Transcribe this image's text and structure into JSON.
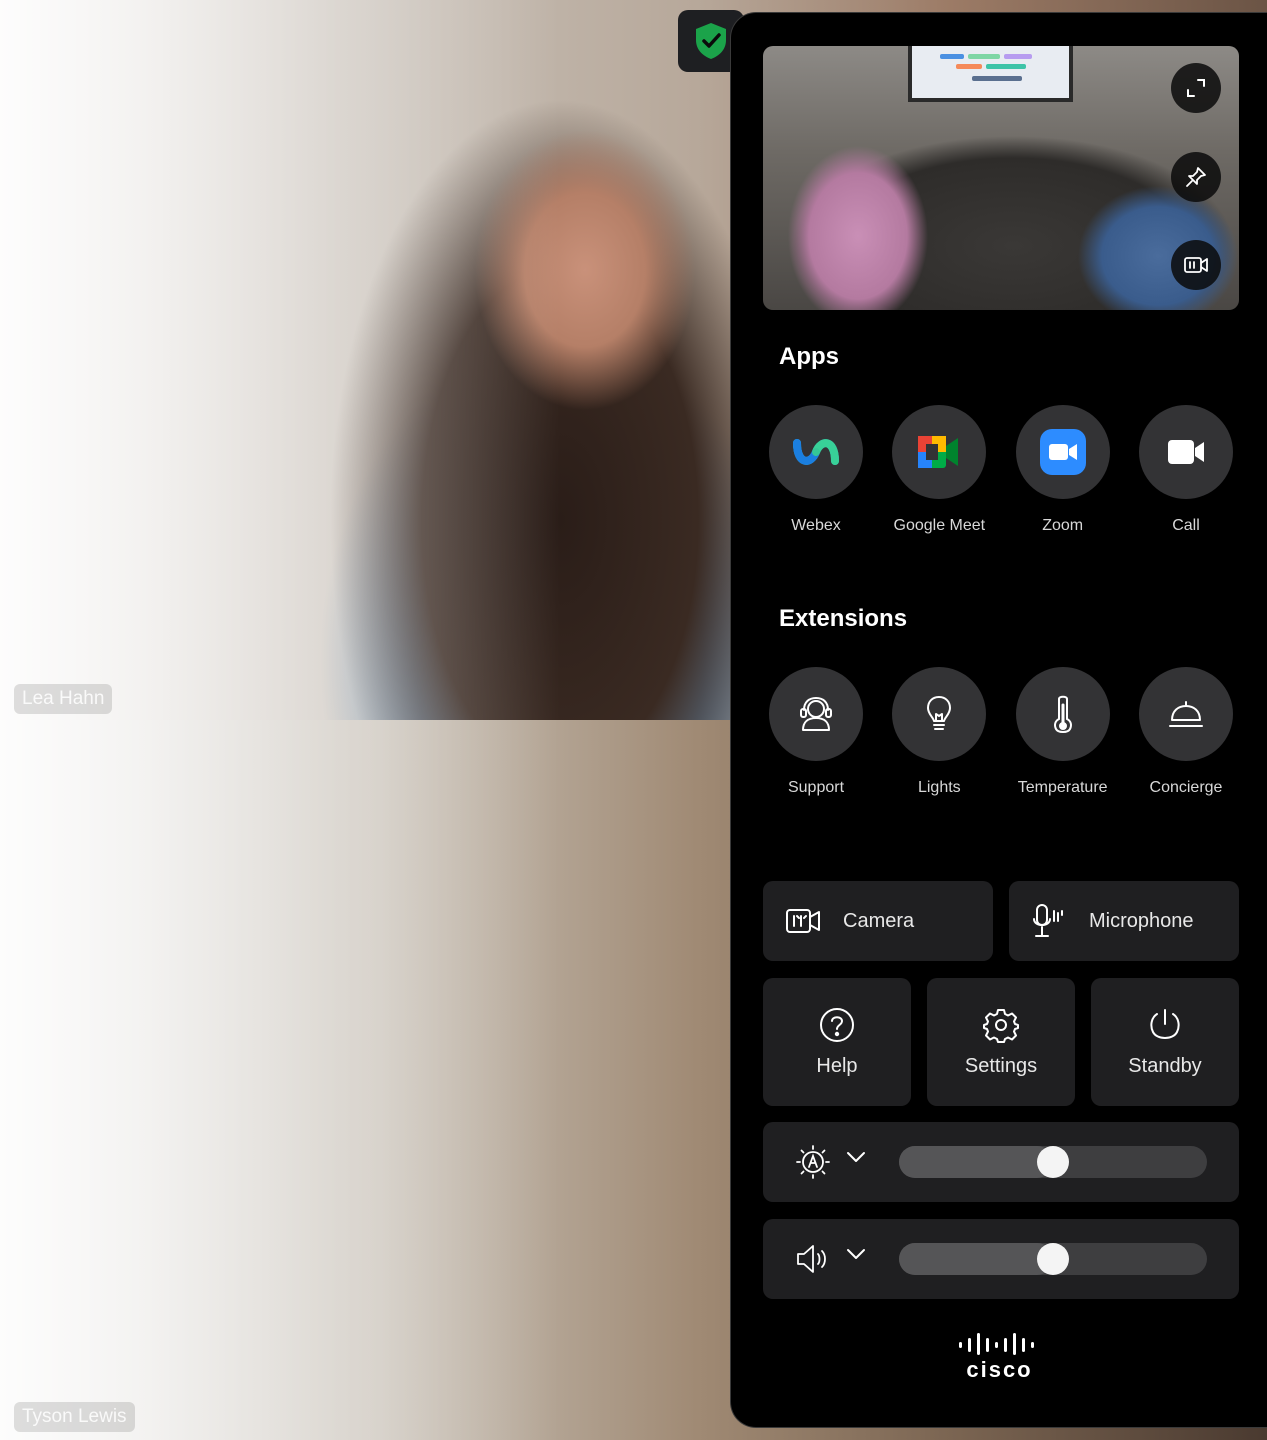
{
  "participants": [
    {
      "name": "Lea Hahn"
    },
    {
      "name": "Tyson Lewis"
    }
  ],
  "security": {
    "icon": "shield-check-icon",
    "color": "#1ba34a"
  },
  "selfview": {
    "buttons": [
      {
        "icon": "fullscreen-icon"
      },
      {
        "icon": "pin-icon"
      },
      {
        "icon": "camera-switch-icon"
      }
    ]
  },
  "apps": {
    "title": "Apps",
    "items": [
      {
        "label": "Webex",
        "icon": "webex-icon"
      },
      {
        "label": "Google Meet",
        "icon": "google-meet-icon"
      },
      {
        "label": "Zoom",
        "icon": "zoom-icon",
        "color": "#2d8cff"
      },
      {
        "label": "Call",
        "icon": "video-call-icon"
      }
    ]
  },
  "extensions": {
    "title": "Extensions",
    "items": [
      {
        "label": "Support",
        "icon": "support-headset-icon"
      },
      {
        "label": "Lights",
        "icon": "lightbulb-icon"
      },
      {
        "label": "Temperature",
        "icon": "thermometer-icon"
      },
      {
        "label": "Concierge",
        "icon": "concierge-bell-icon"
      }
    ]
  },
  "controls": {
    "camera": "Camera",
    "microphone": "Microphone",
    "help": "Help",
    "settings": "Settings",
    "standby": "Standby"
  },
  "sliders": {
    "brightness": {
      "icon": "auto-brightness-icon",
      "value": 0.5
    },
    "volume": {
      "icon": "speaker-icon",
      "value": 0.5
    }
  },
  "brand": {
    "name": "cisco"
  }
}
